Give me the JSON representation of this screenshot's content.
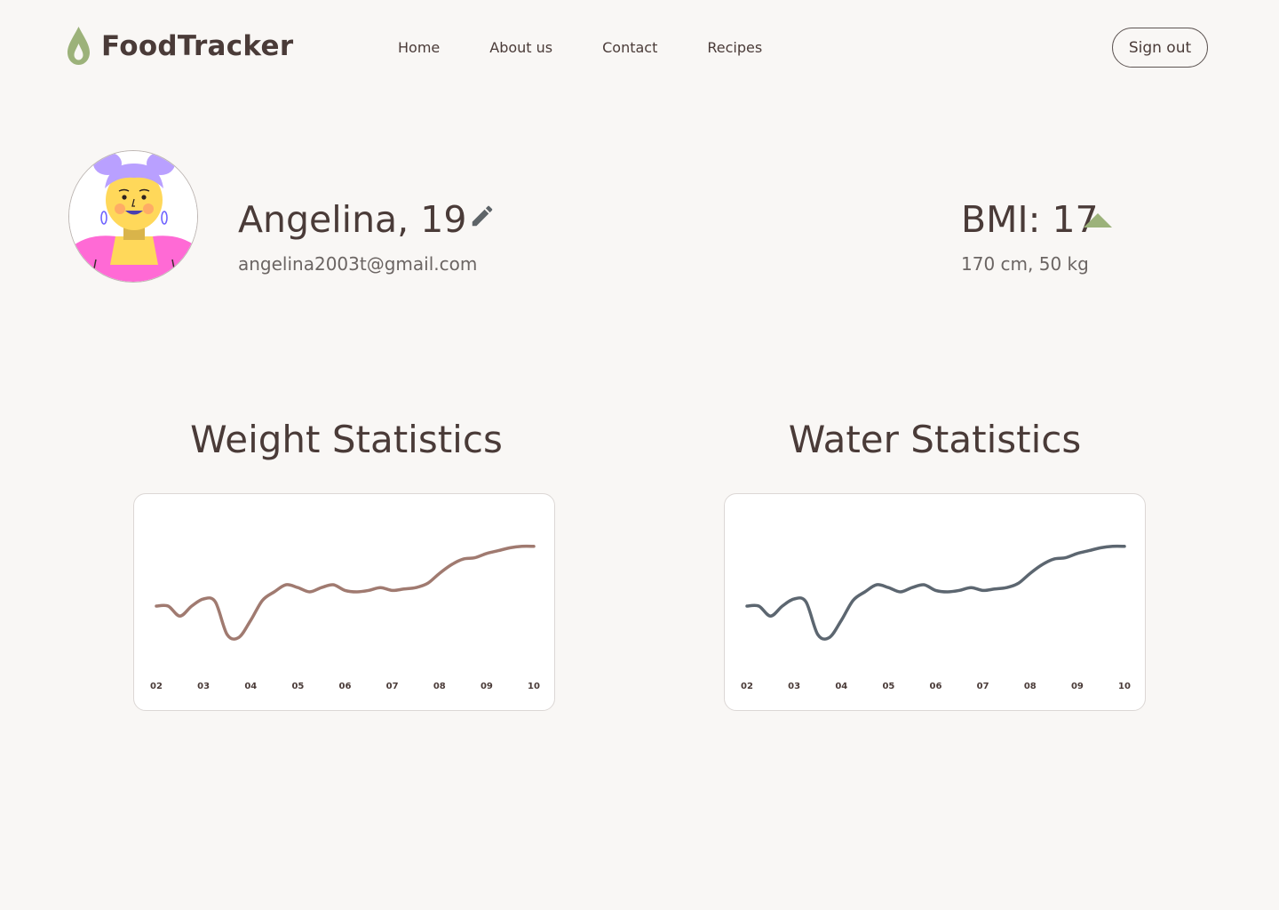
{
  "header": {
    "brand": "FoodTracker",
    "logo_icon": "leaf-drop-icon",
    "nav": [
      {
        "label": "Home"
      },
      {
        "label": "About us"
      },
      {
        "label": "Contact"
      },
      {
        "label": "Recipes"
      }
    ],
    "signout_label": "Sign out"
  },
  "profile": {
    "name": "Angelina, 19",
    "email": "angelina2003t@gmail.com",
    "edit_icon": "pencil-icon",
    "avatar_icon": "avatar-illustration",
    "bmi": "BMI: 17",
    "bmi_trend_icon": "triangle-up-icon",
    "body": "170 cm, 50 kg"
  },
  "colors": {
    "background": "#f9f7f5",
    "text": "#4a3b38",
    "accent": "#9cb27a",
    "weight_line": "#a07a70",
    "water_line": "#5c6670"
  },
  "sections": {
    "weight_title": "Weight Statistics",
    "water_title": "Water Statistics"
  },
  "chart_data": [
    {
      "type": "line",
      "title": "Weight Statistics",
      "xlabel": "",
      "ylabel": "",
      "grid": false,
      "ticks": [
        "02",
        "03",
        "04",
        "05",
        "06",
        "07",
        "08",
        "09",
        "10"
      ],
      "ylim": [
        0,
        1
      ],
      "series": [
        {
          "color": "#a07a70",
          "x": [
            2.0,
            2.25,
            2.5,
            2.75,
            3.0,
            3.25,
            3.5,
            3.75,
            4.0,
            4.25,
            4.5,
            4.75,
            5.0,
            5.25,
            5.5,
            5.75,
            6.0,
            6.25,
            6.5,
            6.75,
            7.0,
            7.25,
            7.5,
            7.75,
            8.0,
            8.25,
            8.5,
            8.75,
            9.0,
            9.25,
            9.5,
            9.75,
            10.0
          ],
          "values": [
            0.4,
            0.4,
            0.33,
            0.4,
            0.45,
            0.43,
            0.2,
            0.18,
            0.3,
            0.44,
            0.5,
            0.55,
            0.53,
            0.5,
            0.53,
            0.55,
            0.51,
            0.5,
            0.51,
            0.53,
            0.51,
            0.52,
            0.53,
            0.56,
            0.63,
            0.69,
            0.73,
            0.74,
            0.77,
            0.79,
            0.81,
            0.82,
            0.82
          ]
        }
      ]
    },
    {
      "type": "line",
      "title": "Water Statistics",
      "xlabel": "",
      "ylabel": "",
      "grid": false,
      "ticks": [
        "02",
        "03",
        "04",
        "05",
        "06",
        "07",
        "08",
        "09",
        "10"
      ],
      "ylim": [
        0,
        1
      ],
      "series": [
        {
          "color": "#5c6670",
          "x": [
            2.0,
            2.25,
            2.5,
            2.75,
            3.0,
            3.25,
            3.5,
            3.75,
            4.0,
            4.25,
            4.5,
            4.75,
            5.0,
            5.25,
            5.5,
            5.75,
            6.0,
            6.25,
            6.5,
            6.75,
            7.0,
            7.25,
            7.5,
            7.75,
            8.0,
            8.25,
            8.5,
            8.75,
            9.0,
            9.25,
            9.5,
            9.75,
            10.0
          ],
          "values": [
            0.4,
            0.4,
            0.33,
            0.4,
            0.45,
            0.43,
            0.2,
            0.18,
            0.3,
            0.44,
            0.5,
            0.55,
            0.53,
            0.5,
            0.53,
            0.55,
            0.51,
            0.5,
            0.51,
            0.53,
            0.51,
            0.52,
            0.53,
            0.56,
            0.63,
            0.69,
            0.73,
            0.74,
            0.77,
            0.79,
            0.81,
            0.82,
            0.82
          ]
        }
      ]
    }
  ]
}
